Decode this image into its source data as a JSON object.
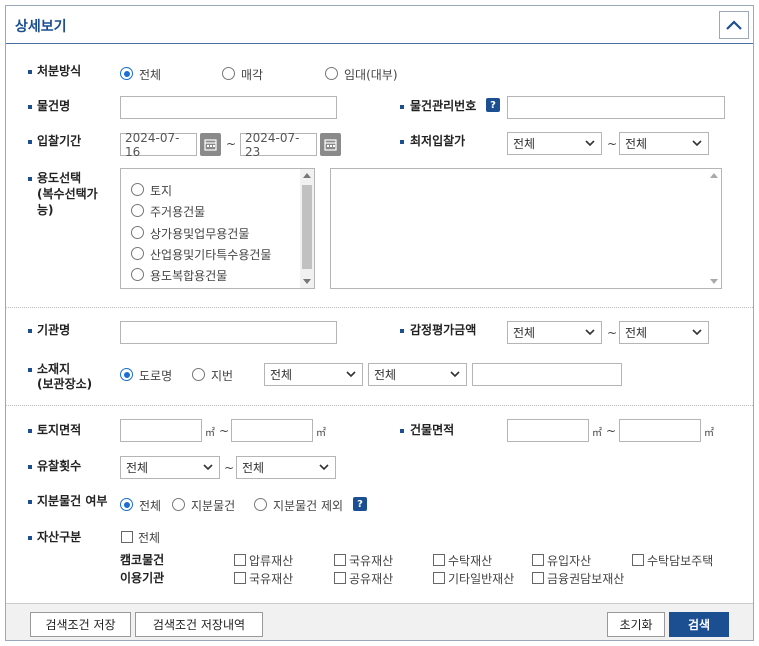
{
  "header": {
    "title": "상세보기"
  },
  "disposal": {
    "label": "처분방식",
    "options": [
      "전체",
      "매각",
      "임대(대부)"
    ],
    "selected": "전체"
  },
  "item_name": {
    "label": "물건명",
    "value": ""
  },
  "item_mgmt_no": {
    "label": "물건관리번호",
    "help": "?",
    "value": ""
  },
  "bid_period": {
    "label": "입찰기간",
    "from": "2024-07-16",
    "to": "2024-07-23",
    "sep": "~"
  },
  "min_bid": {
    "label": "최저입찰가",
    "from": "전체",
    "to": "전체",
    "sep": "~"
  },
  "usage": {
    "label_lines": [
      "용도선택",
      "(복수선택가",
      "능)"
    ],
    "options": [
      "토지",
      "주거용건물",
      "상가용및업무용건물",
      "산업용및기타특수용건물",
      "용도복합용건물"
    ]
  },
  "agency": {
    "label": "기관명",
    "value": ""
  },
  "appraisal": {
    "label": "감정평가금액",
    "from": "전체",
    "to": "전체",
    "sep": "~"
  },
  "location": {
    "label_lines": [
      "소재지",
      "(보관장소)"
    ],
    "options": [
      "도로명",
      "지번"
    ],
    "selected": "도로명",
    "select1": "전체",
    "select2": "전체",
    "detail": ""
  },
  "land_area": {
    "label": "토지면적",
    "unit": "㎡",
    "sep": "~"
  },
  "building_area": {
    "label": "건물면적",
    "unit": "㎡",
    "sep": "~"
  },
  "failed_bids": {
    "label": "유찰횟수",
    "from": "전체",
    "to": "전체",
    "sep": "~"
  },
  "share": {
    "label": "지분물건 여부",
    "options": [
      "전체",
      "지분물건",
      "지분물건 제외"
    ],
    "selected": "전체",
    "help": "?"
  },
  "asset": {
    "label": "자산구분",
    "all": "전체",
    "group1_label": "캠코물건",
    "group1": [
      "압류재산",
      "국유재산",
      "수탁재산",
      "유입자산",
      "수탁담보주택"
    ],
    "group2_label": "이용기관",
    "group2": [
      "국유재산",
      "공유재산",
      "기타일반재산",
      "금융권담보재산"
    ]
  },
  "footer": {
    "save_label": "검색조건 저장",
    "history_label": "검색조건 저장내역",
    "reset_label": "초기화",
    "search_label": "검색"
  },
  "colors": {
    "accent": "#1b4f91",
    "radio": "#1b6fd0"
  }
}
